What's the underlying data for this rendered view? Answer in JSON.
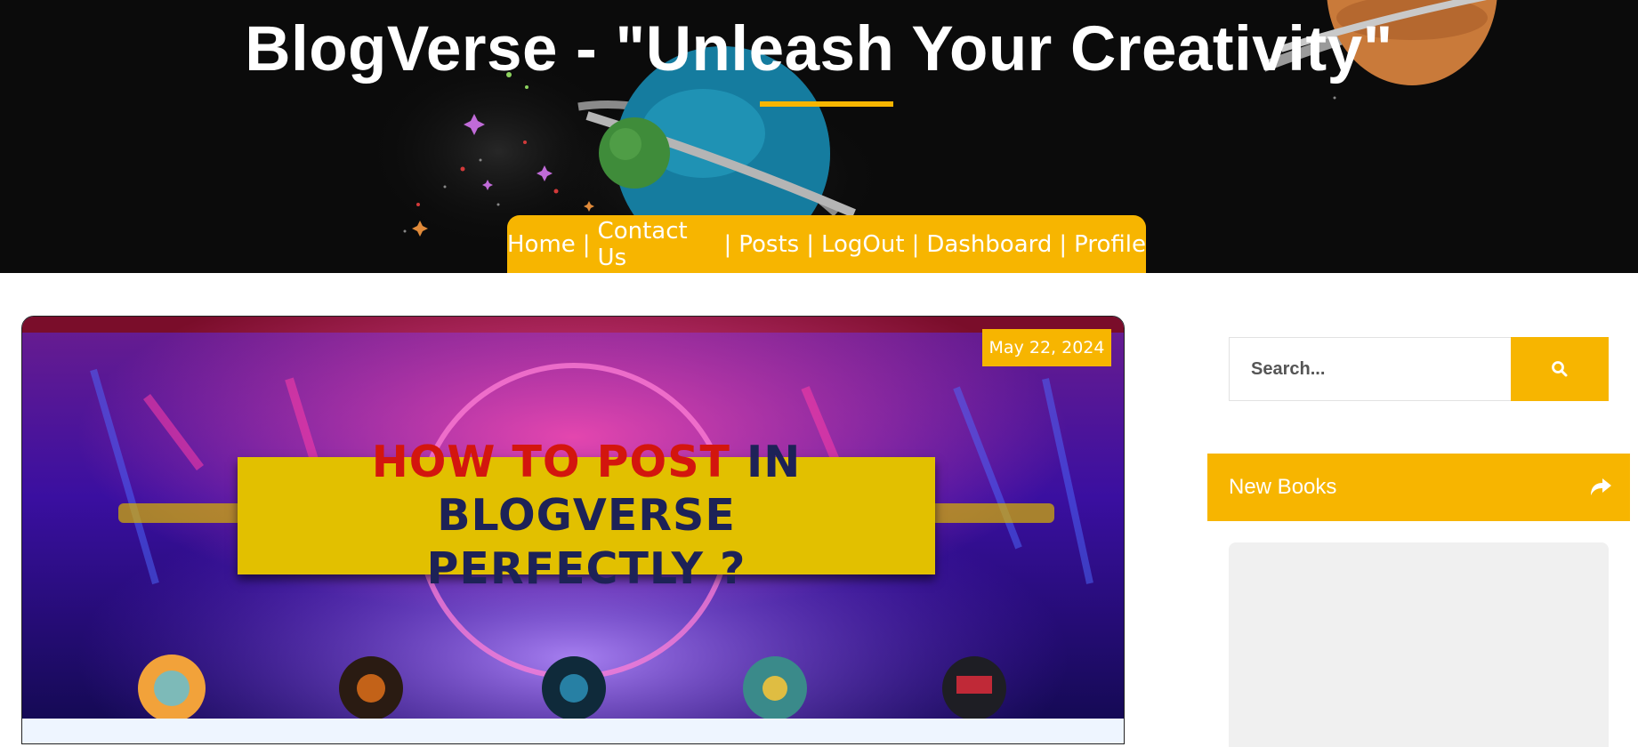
{
  "header": {
    "site_title": "BlogVerse - \"Unleash Your Creativity\""
  },
  "nav": {
    "items": [
      "Home",
      "Contact Us",
      "Posts",
      "LogOut",
      "Dashboard",
      "Profile"
    ],
    "separator": "|"
  },
  "post": {
    "date": "May 22, 2024",
    "thumbnail_title_red": "HOW TO POST",
    "thumbnail_title_dark_1": "IN BLOGVERSE",
    "thumbnail_title_dark_2": "PERFECTLY ?"
  },
  "sidebar": {
    "search_placeholder": "Search...",
    "search_icon": "search-icon",
    "widget_title": "New Books",
    "widget_icon": "share-arrow-icon"
  },
  "colors": {
    "accent": "#f7b500",
    "hero_bg": "#0b0b0b",
    "widget_body": "#f0f0f0"
  }
}
